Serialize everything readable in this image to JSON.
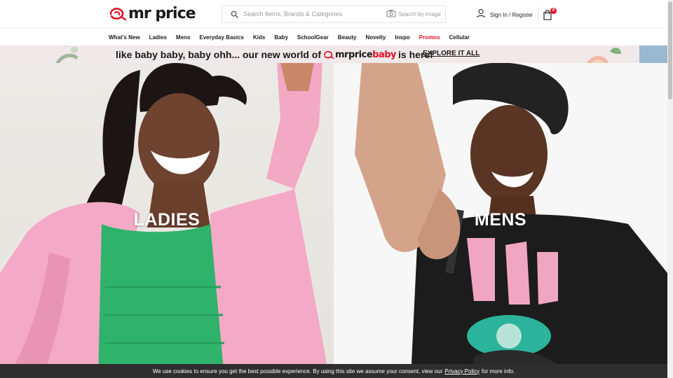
{
  "header": {
    "logo_text": "mr price",
    "search": {
      "placeholder": "Search Items, Brands & Categories",
      "image_search_label": "Search by Image"
    },
    "account_label": "Sign In / Register",
    "cart_count": "0"
  },
  "nav": {
    "items": [
      {
        "label": "What's New"
      },
      {
        "label": "Ladies"
      },
      {
        "label": "Mens"
      },
      {
        "label": "Everyday Basics"
      },
      {
        "label": "Kids"
      },
      {
        "label": "Baby"
      },
      {
        "label": "SchoolGear"
      },
      {
        "label": "Beauty"
      },
      {
        "label": "Novelty"
      },
      {
        "label": "Inspo"
      },
      {
        "label": "Promos",
        "highlight": true
      },
      {
        "label": "Cellular"
      }
    ]
  },
  "promo_banner": {
    "text_before": "like baby baby, baby ohh... our new world of",
    "brand_mrprice": "mrprice",
    "brand_baby": "baby",
    "text_after": "is here!",
    "cta_label": "EXPLORE IT ALL"
  },
  "hero": {
    "ladies_label": "LADIES",
    "mens_label": "MENS"
  },
  "cookie_bar": {
    "text_before": "We use cookies to ensure you get the best possible experience. By using this site we assume your consent, view our",
    "policy_link": "Privacy Policy",
    "text_after": "for more info.",
    "close_symbol": "×"
  },
  "colors": {
    "brand_red": "#e3112a",
    "nav_text": "#1a1a1a",
    "cookie_bg": "#2e2e2e",
    "banner_bg": "#f1e8ea"
  },
  "icons": [
    "mr-price-logo-icon",
    "search-icon",
    "camera-icon",
    "user-icon",
    "shopping-bag-icon",
    "close-icon"
  ]
}
